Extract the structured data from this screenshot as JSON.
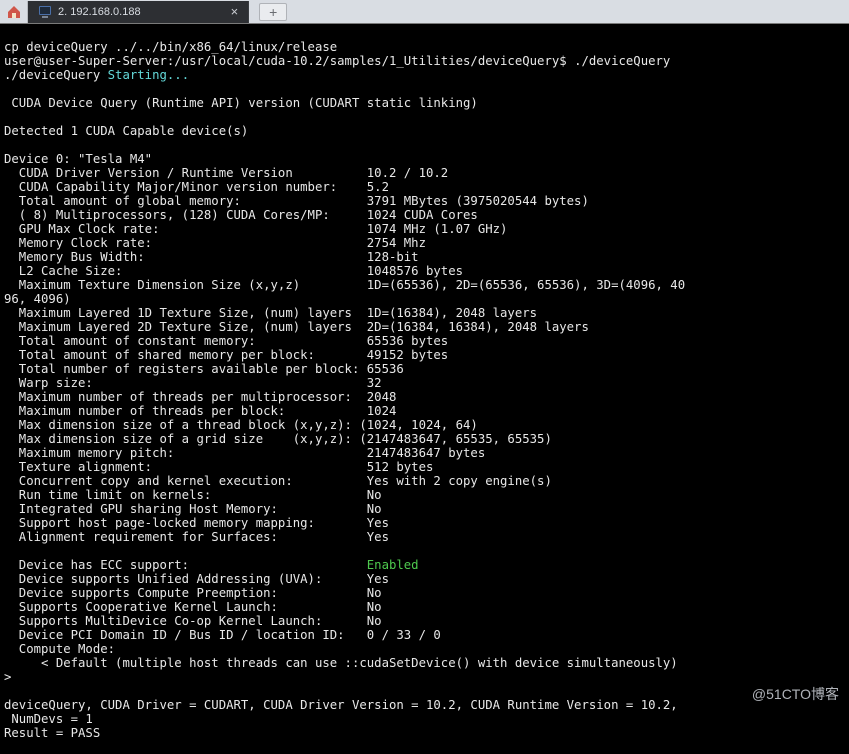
{
  "tabbar": {
    "tab_label": "2. 192.168.0.188",
    "has_close": true,
    "has_plus": true
  },
  "term": {
    "cmd_cp": "cp deviceQuery ../../bin/x86_64/linux/release",
    "prompt_path": "user@user-Super-Server:/usr/local/cuda-10.2/samples/1_Utilities/deviceQuery$ ",
    "prompt_cmd": "./deviceQuery",
    "start_prefix": "./deviceQuery ",
    "start_word": "Starting...",
    "blank1": "",
    "line_runtime": " CUDA Device Query (Runtime API) version (CUDART static linking)",
    "blank2": "",
    "line_detected": "Detected 1 CUDA Capable device(s)",
    "blank3": "",
    "dev_header": "Device 0: \"Tesla M4\"",
    "rows": [
      "  CUDA Driver Version / Runtime Version          10.2 / 10.2",
      "  CUDA Capability Major/Minor version number:    5.2",
      "  Total amount of global memory:                 3791 MBytes (3975020544 bytes)",
      "  ( 8) Multiprocessors, (128) CUDA Cores/MP:     1024 CUDA Cores",
      "  GPU Max Clock rate:                            1074 MHz (1.07 GHz)",
      "  Memory Clock rate:                             2754 Mhz",
      "  Memory Bus Width:                              128-bit",
      "  L2 Cache Size:                                 1048576 bytes",
      "  Maximum Texture Dimension Size (x,y,z)         1D=(65536), 2D=(65536, 65536), 3D=(4096, 40",
      "96, 4096)",
      "  Maximum Layered 1D Texture Size, (num) layers  1D=(16384), 2048 layers",
      "  Maximum Layered 2D Texture Size, (num) layers  2D=(16384, 16384), 2048 layers",
      "  Total amount of constant memory:               65536 bytes",
      "  Total amount of shared memory per block:       49152 bytes",
      "  Total number of registers available per block: 65536",
      "  Warp size:                                     32",
      "  Maximum number of threads per multiprocessor:  2048",
      "  Maximum number of threads per block:           1024",
      "  Max dimension size of a thread block (x,y,z): (1024, 1024, 64)",
      "  Max dimension size of a grid size    (x,y,z): (2147483647, 65535, 65535)",
      "  Maximum memory pitch:                          2147483647 bytes",
      "  Texture alignment:                             512 bytes",
      "  Concurrent copy and kernel execution:          Yes with 2 copy engine(s)",
      "  Run time limit on kernels:                     No",
      "  Integrated GPU sharing Host Memory:            No",
      "  Support host page-locked memory mapping:       Yes",
      "  Alignment requirement for Surfaces:            Yes"
    ],
    "ecc_label": "  Device has ECC support:                        ",
    "ecc_value": "Enabled",
    "rows2": [
      "  Device supports Unified Addressing (UVA):      Yes",
      "  Device supports Compute Preemption:            No",
      "  Supports Cooperative Kernel Launch:            No",
      "  Supports MultiDevice Co-op Kernel Launch:      No",
      "  Device PCI Domain ID / Bus ID / location ID:   0 / 33 / 0",
      "  Compute Mode:",
      "     < Default (multiple host threads can use ::cudaSetDevice() with device simultaneously)",
      ">",
      "",
      "deviceQuery, CUDA Driver = CUDART, CUDA Driver Version = 10.2, CUDA Runtime Version = 10.2,",
      " NumDevs = 1",
      "Result = PASS"
    ]
  },
  "watermark": "@51CTO博客"
}
